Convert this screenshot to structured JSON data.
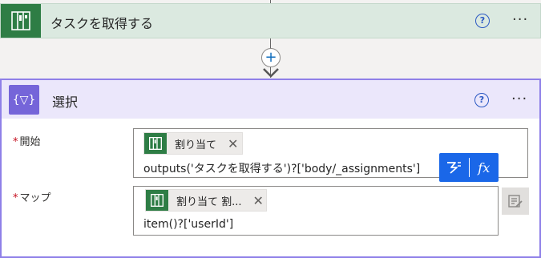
{
  "card1": {
    "title": "タスクを取得する",
    "help_glyph": "?",
    "more_glyph": "···",
    "icon": "planner-icon",
    "accent": "#2e7d45"
  },
  "connector": {
    "add_glyph": "+"
  },
  "card2": {
    "title": "選択",
    "header_icon_text": "{▽}",
    "help_glyph": "?",
    "more_glyph": "···",
    "accent": "#7565d9",
    "fields": {
      "start": {
        "required_mark": "*",
        "label": "開始",
        "token_label": "割り当て",
        "token_close": "✕",
        "expression": "outputs('タスクを取得する')?['body/_assignments']"
      },
      "map": {
        "required_mark": "*",
        "label": "マップ",
        "token_label": "割り当て 割...",
        "token_close": "✕",
        "expression": "item()?['userId']"
      }
    },
    "dynamic_buttons": {
      "dynamic_content_icon": "lightning-icon",
      "expression_label": "fx"
    }
  }
}
